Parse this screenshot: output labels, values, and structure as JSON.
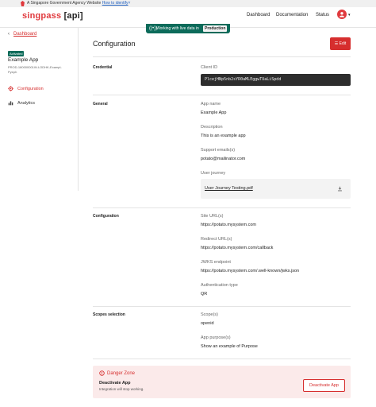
{
  "gov_banner": {
    "text": "A Singapore Government Agency Website",
    "link": "How to identify"
  },
  "header": {
    "logo_brand": "singpass",
    "logo_api": "[api]",
    "nav": [
      "Dashboard",
      "Documentation",
      "Status"
    ]
  },
  "live_pill": {
    "text": "Working with live data in",
    "env": "Production"
  },
  "sidebar": {
    "back_label": "Dashboard",
    "status_badge": "Activated",
    "app_name": "Example App",
    "app_id": "PROD-180000001W-LODHK-Exampl-Pyeph",
    "items": [
      {
        "label": "Configuration",
        "icon": "gear-icon",
        "active": true
      },
      {
        "label": "Analytics",
        "icon": "chart-icon",
        "active": false
      }
    ]
  },
  "main": {
    "title": "Configuration",
    "edit_label": "Edit",
    "credential": {
      "section": "Credential",
      "client_id_label": "Client ID",
      "client_id_value": "PlcejHNp5nb2sYR0aMLEggwTUaLiSpdd"
    },
    "general": {
      "section": "General",
      "app_name_label": "App name",
      "app_name_value": "Example App",
      "description_label": "Description",
      "description_value": "This is an example app",
      "support_label": "Support emails(s)",
      "support_value": "potato@mailinator.com",
      "journey_label": "User journey",
      "journey_file": "User Journey Testing.pdf"
    },
    "configuration": {
      "section": "Configuration",
      "site_label": "Site URL(s)",
      "site_value": "https://potato.mysystem.com",
      "redirect_label": "Redirect URL(s)",
      "redirect_value": "https://potato.mysystem.com/callback",
      "jwks_label": "JWKS endpoint",
      "jwks_value": "https://potato.mysystem.com/.well-known/jwks.json",
      "auth_label": "Authentication type",
      "auth_value": "QR"
    },
    "scopes": {
      "section": "Scopes selection",
      "scope_label": "Scope(s)",
      "scope_value": "openid",
      "purpose_label": "App purpose(s)",
      "purpose_value": "Show an example of Purpose"
    },
    "danger": {
      "heading": "Danger Zone",
      "title": "Deactivate App",
      "description": "Integration will stop working.",
      "button": "Deactivate App"
    }
  },
  "colors": {
    "brand_red": "#d62e2e",
    "live_green": "#0c6b5a"
  }
}
